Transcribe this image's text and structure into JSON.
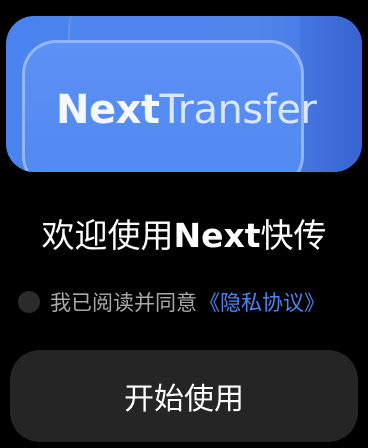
{
  "hero": {
    "logo_word1": "Next",
    "logo_word2": "Transfer"
  },
  "welcome": {
    "prefix": "欢迎使用",
    "brand": "Next",
    "suffix": "快传"
  },
  "agreement": {
    "checked": false,
    "text": "我已阅读并同意",
    "link_text": "《隐私协议》"
  },
  "start_button": {
    "label": "开始使用"
  },
  "colors": {
    "background": "#000000",
    "hero_blue": "#4a82ef",
    "link_blue": "#4d86f0",
    "button_bg": "#252525"
  }
}
